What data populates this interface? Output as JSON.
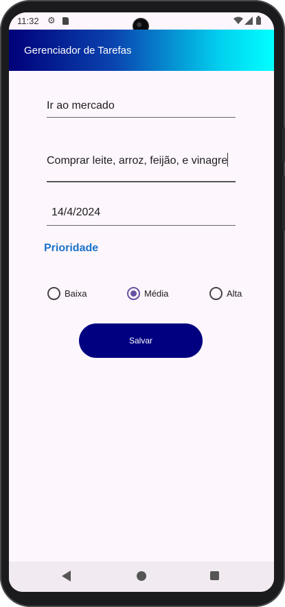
{
  "status_bar": {
    "time": "11:32",
    "icons": [
      "gear-icon",
      "sd-card-icon",
      "wifi-icon",
      "signal-icon",
      "battery-icon"
    ]
  },
  "app_bar": {
    "title": "Gerenciador de Tarefas"
  },
  "form": {
    "title_value": "Ir ao mercado",
    "description_value": "Comprar leite, arroz, feijão, e vinagre",
    "date_value": "14/4/2024",
    "priority_label": "Prioridade",
    "priority_options": [
      {
        "label": "Baixa",
        "checked": false
      },
      {
        "label": "Média",
        "checked": true
      },
      {
        "label": "Alta",
        "checked": false
      }
    ],
    "save_label": "Salvar"
  },
  "colors": {
    "app_bar_gradient_start": "#00007a",
    "app_bar_gradient_end": "#00ffff",
    "accent_label": "#1a73c8",
    "radio_checked": "#6750a4",
    "save_button": "#000080"
  },
  "nav_bar": {
    "icons": [
      "back-icon",
      "home-icon",
      "recents-icon"
    ]
  }
}
